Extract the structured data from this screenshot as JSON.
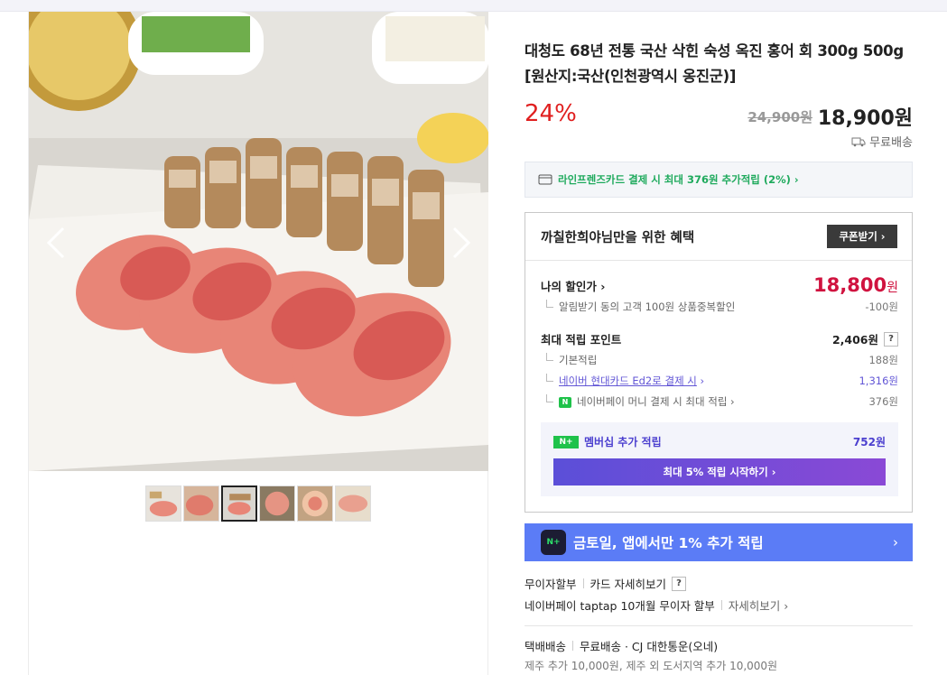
{
  "product": {
    "title": "대청도 68년 전통 국산 삭힌 숙성 옥진 홍어 회 300g 500g [원산지:국산(인천광역시 옹진군)]",
    "discount_rate": "24%",
    "original_price": "24,900원",
    "sale_price": "18,900원",
    "shipping": "무료배송"
  },
  "card_banner": {
    "text": "라인프렌즈카드 결제 시 최대 376원 추가적립 (2%) ›"
  },
  "benefits": {
    "heading": "까칠한희야님만을 위한 혜택",
    "coupon_button": "쿠폰받기 ›",
    "my_price_label": "나의 할인가 ›",
    "my_price_value": "18,800",
    "my_price_unit": "원",
    "alarm_discount_label": "알림받기 동의 고객 100원 상품중복할인",
    "alarm_discount_value": "-100원",
    "max_points_label": "최대 적립 포인트",
    "max_points_value": "2,406원",
    "base_points_label": "기본적립",
    "base_points_value": "188원",
    "hyundai_label": "네이버 현대카드 Ed2로 결제 시",
    "hyundai_chev": "›",
    "hyundai_value": "1,316원",
    "npay_money_label": "네이버페이 머니 결제 시 최대 적립 ›",
    "npay_money_value": "376원",
    "membership_badge": "N+",
    "membership_label": "멤버십 추가 적립",
    "membership_value": "752원",
    "membership_button": "최대 5% 적립 시작하기 ›",
    "qmark": "?"
  },
  "promo": {
    "icon_text": "N+",
    "text": "금토일, 앱에서만 1% 추가 적립",
    "chevron": "›"
  },
  "payment": {
    "installment": "무이자할부",
    "card_detail": "카드 자세히보기",
    "qmark": "?",
    "taptap": "네이버페이 taptap 10개월 무이자 할부",
    "detail": "자세히보기 ›"
  },
  "delivery": {
    "label": "택배배송",
    "info": "무료배송 · CJ 대한통운(오네)",
    "extra": "제주 추가 10,000원, 제주 외 도서지역 추가 10,000원"
  },
  "colors": {
    "discount_red": "#e02020",
    "my_price_red": "#d0133f",
    "naver_green": "#1fc24a",
    "promo_blue": "#5b7cf6",
    "membership_purple": "#5b4fd8"
  },
  "icons": {
    "gallery_prev": "chevron-left-icon",
    "gallery_next": "chevron-right-icon",
    "truck": "truck-icon",
    "card": "credit-card-icon"
  }
}
